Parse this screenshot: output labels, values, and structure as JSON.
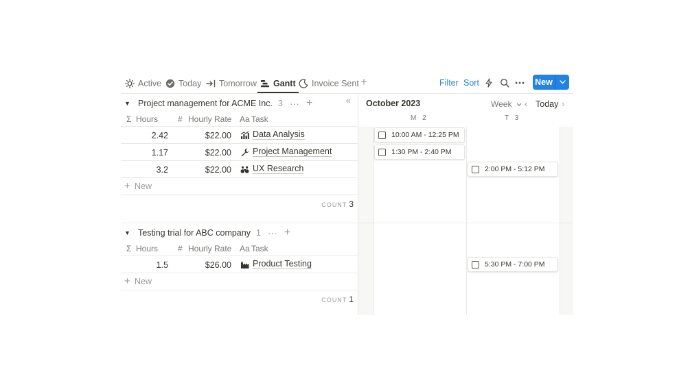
{
  "tabs": [
    {
      "label": "Active",
      "icon": "sun-icon"
    },
    {
      "label": "Today",
      "icon": "check-circle-icon"
    },
    {
      "label": "Tomorrow",
      "icon": "arrow-right-bar-icon"
    },
    {
      "label": "Gantt",
      "icon": "gantt-icon",
      "active": true
    },
    {
      "label": "Invoice Sent",
      "icon": "moon-icon"
    }
  ],
  "toolbar": {
    "filter": "Filter",
    "sort": "Sort",
    "new_label": "New"
  },
  "groups": [
    {
      "title": "Project management for ACME Inc.",
      "count": "3",
      "columns": {
        "hours": "Hours",
        "rate": "Hourly Rate",
        "task": "Task"
      },
      "rows": [
        {
          "hours": "2.42",
          "rate": "$22.00",
          "task": "Data Analysis",
          "icon": "chart-icon"
        },
        {
          "hours": "1.17",
          "rate": "$22.00",
          "task": "Project Management",
          "icon": "wrench-icon"
        },
        {
          "hours": "3.2",
          "rate": "$22.00",
          "task": "UX Research",
          "icon": "binoculars-icon"
        }
      ],
      "new_label": "New",
      "count_label": "COUNT",
      "count_value": "3"
    },
    {
      "title": "Testing trial for ABC company",
      "count": "1",
      "columns": {
        "hours": "Hours",
        "rate": "Hourly Rate",
        "task": "Task"
      },
      "rows": [
        {
          "hours": "1.5",
          "rate": "$26.00",
          "task": "Product Testing",
          "icon": "factory-icon"
        }
      ],
      "new_label": "New",
      "count_label": "COUNT",
      "count_value": "1"
    }
  ],
  "timeline": {
    "month": "October 2023",
    "view": "Week",
    "today": "Today",
    "days": [
      {
        "letter": "M",
        "num": "2"
      },
      {
        "letter": "T",
        "num": "3"
      }
    ],
    "bars": [
      {
        "label": "10:00 AM - 12:25 PM"
      },
      {
        "label": "1:30 PM - 2:40 PM"
      },
      {
        "label": "2:00 PM - 5:12 PM"
      },
      {
        "label": "5:30 PM - 7:00 PM"
      }
    ]
  },
  "colors": {
    "accent": "#2383e2",
    "text": "#37352f",
    "muted": "#9b9a97"
  }
}
